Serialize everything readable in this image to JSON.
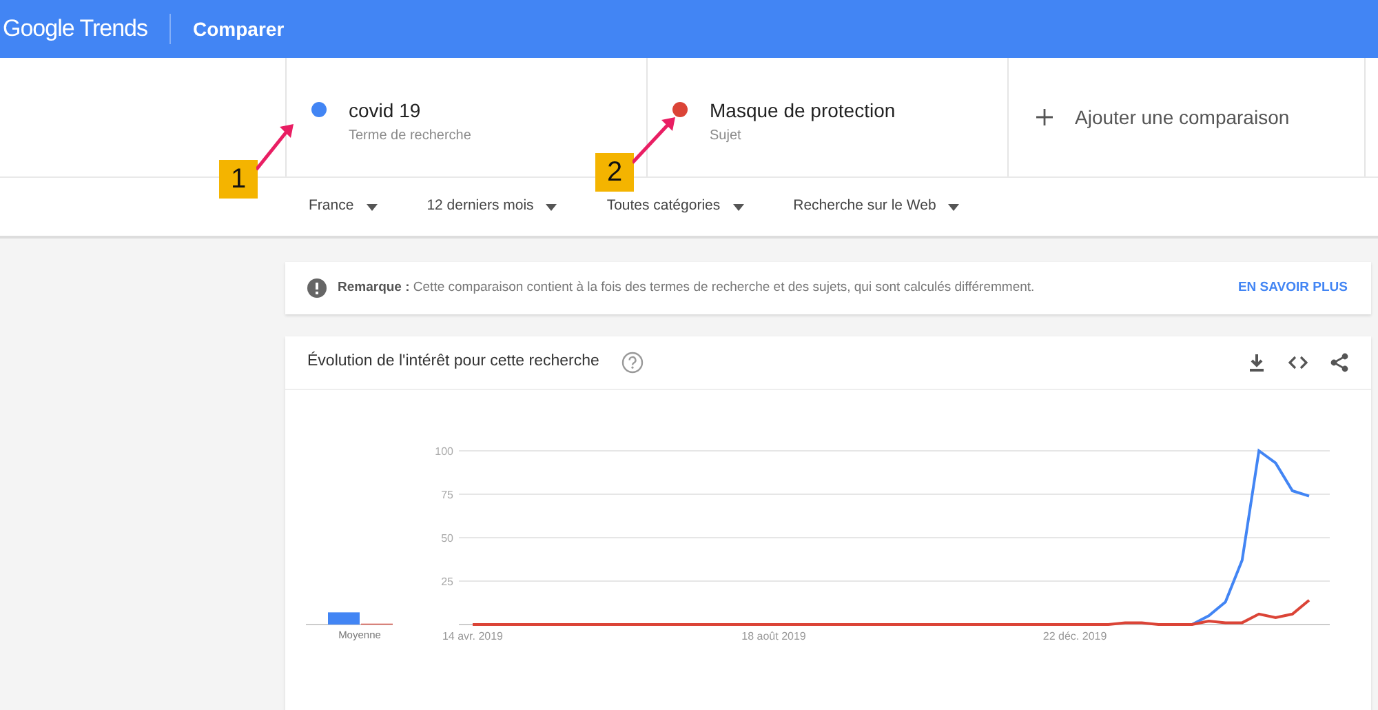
{
  "header": {
    "logo": "Google Trends",
    "title": "Comparer"
  },
  "terms": [
    {
      "name": "covid 19",
      "type": "Terme de recherche",
      "color": "#4285f4"
    },
    {
      "name": "Masque de protection",
      "type": "Sujet",
      "color": "#db4437"
    }
  ],
  "add_comparison": "Ajouter une comparaison",
  "filters": [
    "France",
    "12 derniers mois",
    "Toutes catégories",
    "Recherche sur le Web"
  ],
  "note": {
    "text": "**Remarque :** Cette comparaison contient à la fois des termes de recherche et des sujets, qui sont calculés différemment.",
    "link": "EN SAVOIR PLUS"
  },
  "callouts": [
    {
      "label": "1"
    },
    {
      "label": "2"
    }
  ],
  "interest_card": {
    "title": "Évolution de l'intérêt pour cette recherche",
    "averages": {
      "chart_data": {
        "type": "bar",
        "categories": [
          "Moyenne"
        ],
        "ylim": [
          0,
          100
        ],
        "series": [
          {
            "color": "#4285f4",
            "values": [
              7
            ]
          },
          {
            "color": "#db4437",
            "values": [
              0.5
            ]
          }
        ]
      }
    },
    "chart_data": {
      "type": "line",
      "categories": [
        "14 avr. 2019",
        null,
        null,
        null,
        null,
        null,
        null,
        null,
        null,
        null,
        null,
        null,
        null,
        null,
        null,
        null,
        null,
        null,
        "18 août 2019",
        null,
        null,
        null,
        null,
        null,
        null,
        null,
        null,
        null,
        null,
        null,
        null,
        null,
        null,
        null,
        null,
        null,
        "22 déc. 2019",
        null,
        null,
        null,
        null,
        null,
        null,
        null,
        null,
        null,
        null,
        null,
        null,
        null,
        null
      ],
      "ylim": [
        0,
        100
      ],
      "yticks": [
        25,
        50,
        75,
        100
      ],
      "grid": true,
      "series": [
        {
          "color": "#4285f4",
          "values": [
            null,
            null,
            null,
            null,
            null,
            null,
            null,
            null,
            null,
            null,
            null,
            null,
            null,
            null,
            null,
            null,
            null,
            null,
            null,
            null,
            null,
            null,
            null,
            null,
            null,
            null,
            null,
            null,
            null,
            null,
            null,
            null,
            null,
            null,
            null,
            null,
            null,
            null,
            null,
            null,
            null,
            null,
            null,
            0,
            5,
            13,
            37,
            100,
            93,
            77,
            74
          ]
        },
        {
          "color": "#db4437",
          "values": [
            0,
            0,
            0,
            0,
            0,
            0,
            0,
            0,
            0,
            0,
            0,
            0,
            0,
            0,
            0,
            0,
            0,
            0,
            0,
            0,
            0,
            0,
            0,
            0,
            0,
            0,
            0,
            0,
            0,
            0,
            0,
            0,
            0,
            0,
            0,
            0,
            0,
            0,
            0,
            1,
            1,
            0,
            0,
            0,
            2,
            1,
            1,
            6,
            4,
            6,
            14
          ]
        }
      ]
    }
  }
}
